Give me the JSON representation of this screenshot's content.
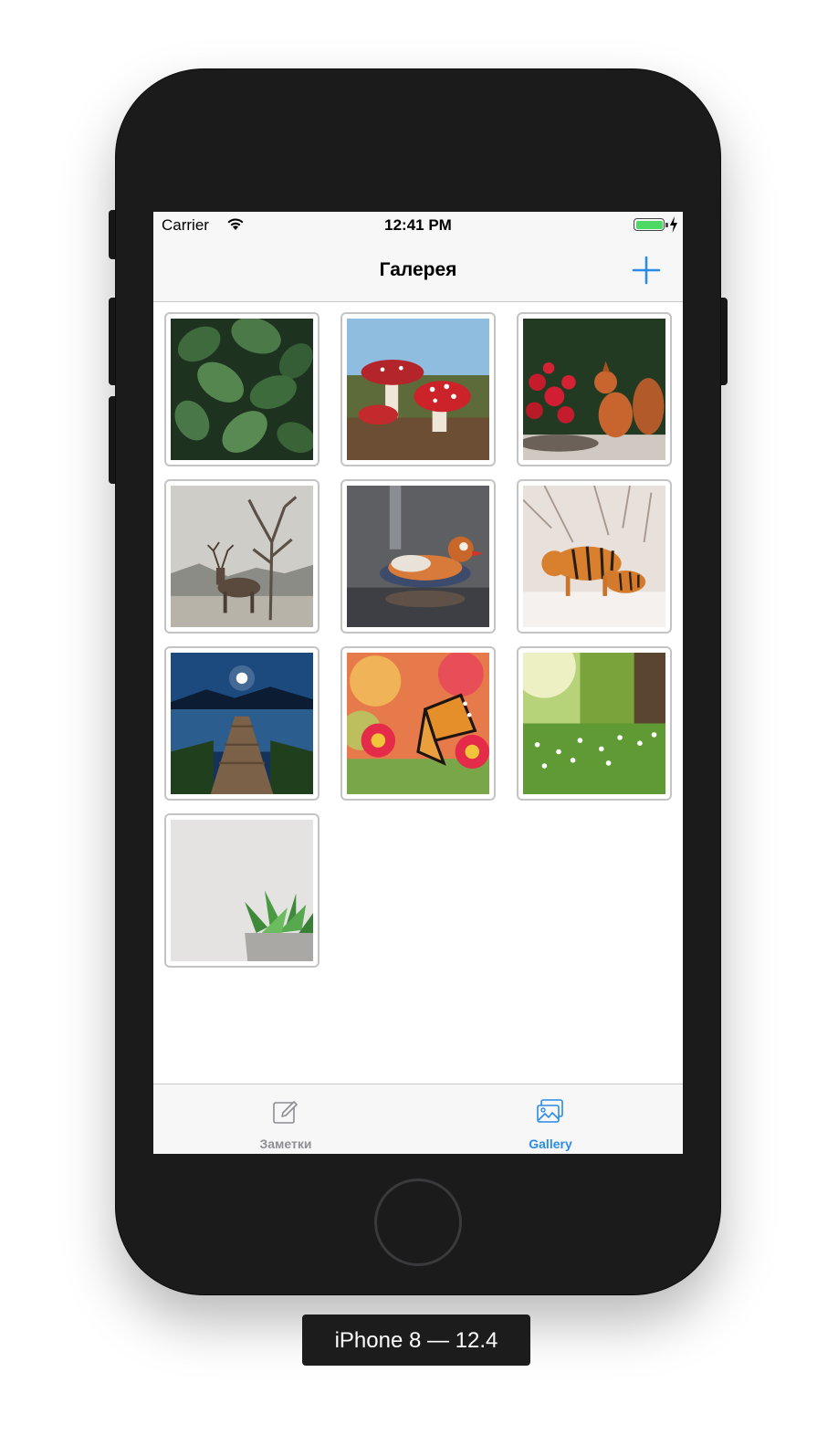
{
  "status_bar": {
    "carrier": "Carrier",
    "time": "12:41 PM"
  },
  "nav": {
    "title": "Галерея",
    "add_icon": "plus-icon"
  },
  "gallery": {
    "photos": [
      {
        "subject": "leaves",
        "name": "photo-leaves"
      },
      {
        "subject": "mushrooms",
        "name": "photo-mushrooms"
      },
      {
        "subject": "squirrel",
        "name": "photo-squirrel"
      },
      {
        "subject": "deer",
        "name": "photo-deer"
      },
      {
        "subject": "mandarin duck",
        "name": "photo-duck"
      },
      {
        "subject": "tigers",
        "name": "photo-tigers"
      },
      {
        "subject": "pier at night",
        "name": "photo-pier"
      },
      {
        "subject": "butterfly",
        "name": "photo-butterfly"
      },
      {
        "subject": "meadow",
        "name": "photo-meadow"
      },
      {
        "subject": "succulent",
        "name": "photo-succulent"
      }
    ]
  },
  "tab_bar": {
    "tabs": [
      {
        "label": "Заметки",
        "icon": "pencil-square-icon",
        "selected": false
      },
      {
        "label": "Gallery",
        "icon": "photos-icon",
        "selected": true
      }
    ]
  },
  "colors": {
    "accent": "#2a8ce6",
    "inactive": "#8e8e93",
    "battery": "#4cd964"
  },
  "device": {
    "label": "iPhone 8 — 12.4"
  }
}
